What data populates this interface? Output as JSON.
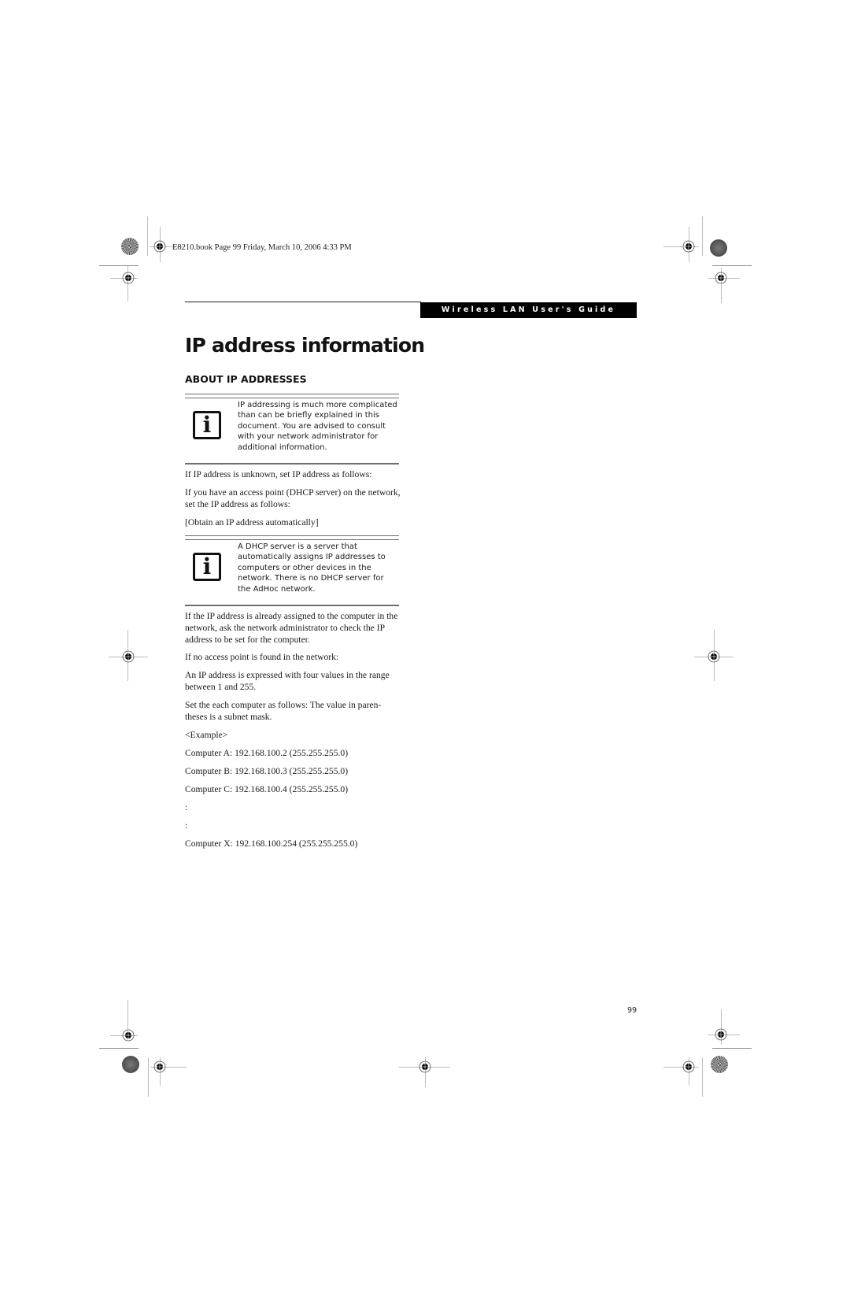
{
  "slug": "E8210.book  Page 99  Friday, March 10, 2006  4:33 PM",
  "header": {
    "running_title": "Wireless LAN User's Guide"
  },
  "page_title": "IP address information",
  "section_title": "ABOUT IP ADDRESSES",
  "notes": [
    {
      "icon": "info-icon",
      "glyph": "i",
      "text": "IP addressing is much more complicated than can be briefly explained in this document. You are advised to consult with your network administrator for additional information."
    },
    {
      "icon": "info-icon",
      "glyph": "i",
      "text": "A DHCP server is a server that automatically assigns IP addresses to computers or other devices in the network. There is no DHCP server for the AdHoc network."
    }
  ],
  "paragraphs": {
    "p1": "If IP address is unknown, set IP address as follows:",
    "p2": "If you have an access point (DHCP server) on the network, set the IP address as follows:",
    "p3": "[Obtain an IP address automatically]",
    "p4": "If the IP address is already assigned to the computer in the network, ask the network administrator to check the IP address to be set for the computer.",
    "p5": "If no access point is found in the network:",
    "p6": "An IP address is expressed with four values in the range between 1 and 255.",
    "p7": "Set the each computer as follows: The value in paren-theses is a subnet mask.",
    "p8": "<Example>"
  },
  "examples": [
    "Computer A: 192.168.100.2 (255.255.255.0)",
    "Computer B: 192.168.100.3 (255.255.255.0)",
    "Computer C: 192.168.100.4 (255.255.255.0)",
    ":",
    ":",
    "Computer X: 192.168.100.254 (255.255.255.0)"
  ],
  "page_number": "99"
}
